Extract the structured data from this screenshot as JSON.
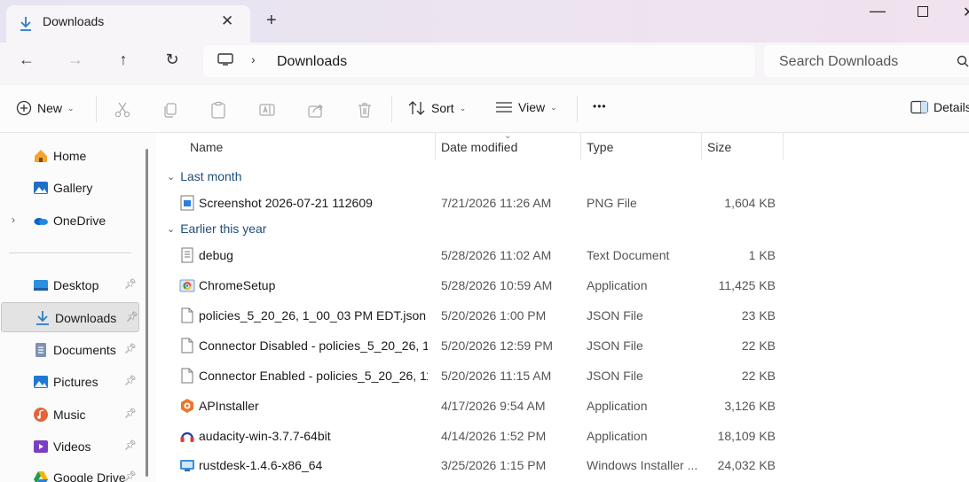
{
  "window": {
    "tab_title": "Downloads",
    "tab_close": "✕",
    "new_tab": "+",
    "minimize": "—",
    "close": "✕"
  },
  "nav": {
    "back": "←",
    "forward": "→",
    "up": "↑",
    "refresh": "↻",
    "breadcrumb_sep": "›",
    "location": "Downloads"
  },
  "search": {
    "placeholder": "Search Downloads"
  },
  "toolbar": {
    "new_label": "New",
    "sort_label": "Sort",
    "view_label": "View",
    "more_label": "•••",
    "details_label": "Details",
    "caret": "⌄"
  },
  "sidebar": {
    "items": [
      {
        "label": "Home",
        "icon": "home-icon"
      },
      {
        "label": "Gallery",
        "icon": "gallery-icon"
      },
      {
        "label": "OneDrive",
        "icon": "onedrive-icon",
        "expander": "›"
      },
      {
        "label": "Desktop",
        "icon": "desktop-icon",
        "pinned": true
      },
      {
        "label": "Downloads",
        "icon": "downloads-icon",
        "pinned": true,
        "selected": true
      },
      {
        "label": "Documents",
        "icon": "documents-icon",
        "pinned": true
      },
      {
        "label": "Pictures",
        "icon": "pictures-icon",
        "pinned": true
      },
      {
        "label": "Music",
        "icon": "music-icon",
        "pinned": true
      },
      {
        "label": "Videos",
        "icon": "videos-icon",
        "pinned": true
      },
      {
        "label": "Google Drive",
        "icon": "google-drive-icon",
        "pinned": true
      }
    ],
    "pin_glyph": "📌"
  },
  "columns": {
    "name": "Name",
    "date": "Date modified",
    "type": "Type",
    "size": "Size"
  },
  "groups": [
    {
      "label": "Last month",
      "chevron": "⌄"
    },
    {
      "label": "Earlier this year",
      "chevron": "⌄"
    }
  ],
  "files": [
    {
      "name": "Screenshot 2026-07-21 112609",
      "date": "7/21/2026 11:26 AM",
      "type": "PNG File",
      "size": "1,604 KB",
      "icon": "image-file-icon"
    },
    {
      "name": "debug",
      "date": "5/28/2026 11:02 AM",
      "type": "Text Document",
      "size": "1 KB",
      "icon": "text-file-icon"
    },
    {
      "name": "ChromeSetup",
      "date": "5/28/2026 10:59 AM",
      "type": "Application",
      "size": "11,425 KB",
      "icon": "chrome-setup-icon"
    },
    {
      "name": "policies_5_20_26, 1_00_03 PM EDT.json",
      "date": "5/20/2026 1:00 PM",
      "type": "JSON File",
      "size": "23 KB",
      "icon": "json-file-icon"
    },
    {
      "name": "Connector Disabled - policies_5_20_26, 1...",
      "date": "5/20/2026 12:59 PM",
      "type": "JSON File",
      "size": "22 KB",
      "icon": "json-file-icon"
    },
    {
      "name": "Connector Enabled - policies_5_20_26, 11...",
      "date": "5/20/2026 11:15 AM",
      "type": "JSON File",
      "size": "22 KB",
      "icon": "json-file-icon"
    },
    {
      "name": "APInstaller",
      "date": "4/17/2026 9:54 AM",
      "type": "Application",
      "size": "3,126 KB",
      "icon": "apinstaller-icon"
    },
    {
      "name": "audacity-win-3.7.7-64bit",
      "date": "4/14/2026 1:52 PM",
      "type": "Application",
      "size": "18,109 KB",
      "icon": "audacity-icon"
    },
    {
      "name": "rustdesk-1.4.6-x86_64",
      "date": "3/25/2026 1:15 PM",
      "type": "Windows Installer ...",
      "size": "24,032 KB",
      "icon": "installer-icon"
    }
  ],
  "colors": {
    "accent": "#0067c0",
    "selected_bg": "#e3e3e3",
    "group_text": "#1f4e79"
  }
}
